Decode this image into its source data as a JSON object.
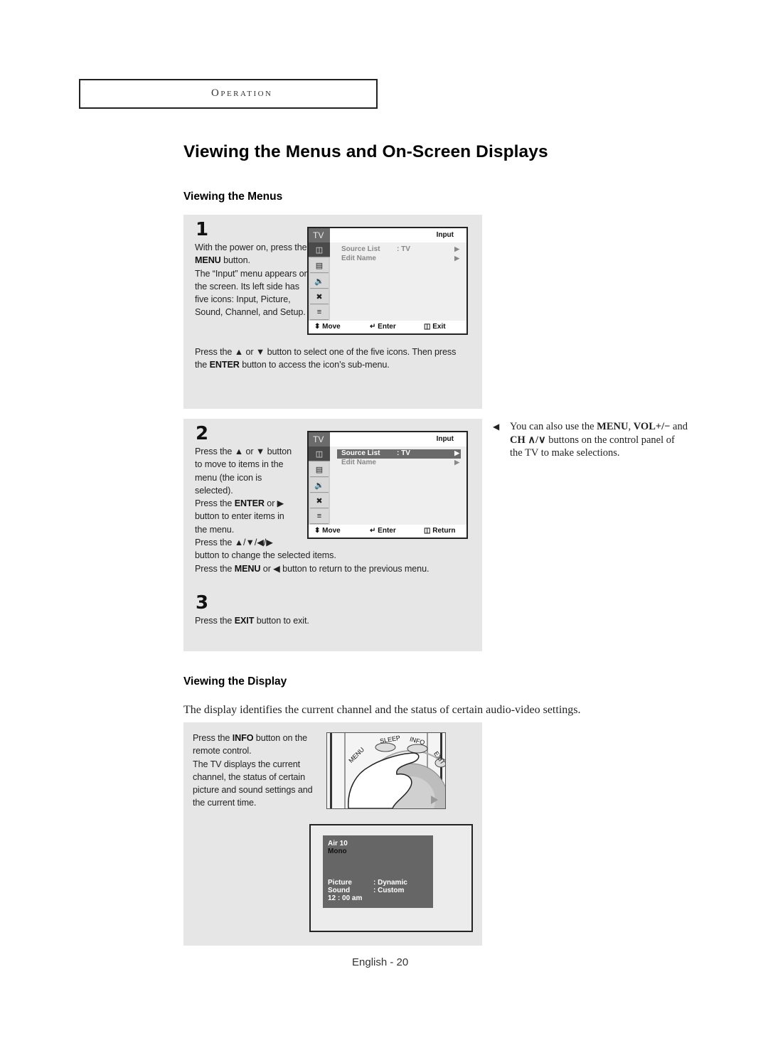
{
  "header": {
    "section": "Operation"
  },
  "page_title": "Viewing the Menus and On-Screen Displays",
  "viewing_menus": {
    "heading": "Viewing the Menus",
    "step1": {
      "number": "1",
      "text_parts": [
        "With the power on, press the ",
        "MENU",
        " button.",
        "The “Input” menu appears on the screen. Its left side has five icons: Input, Picture, Sound, Channel, and Setup."
      ],
      "after_parts": [
        "Press the ▲ or ▼ button to select one of the five icons. Then press the ",
        "ENTER",
        " button to access the icon’s sub-menu."
      ],
      "osd": {
        "tv_label": "TV",
        "title": "Input",
        "icons": [
          "input-icon",
          "picture-icon",
          "sound-icon",
          "channel-icon",
          "setup-icon"
        ],
        "selected_icon": 0,
        "rows": [
          {
            "label": "Source List",
            "value": ": TV",
            "arrow": "▶",
            "highlighted": false
          },
          {
            "label": "Edit Name",
            "value": "",
            "arrow": "▶",
            "highlighted": false
          }
        ],
        "footer": {
          "move": "Move",
          "enter": "Enter",
          "exit": "Exit"
        }
      }
    },
    "step2": {
      "number": "2",
      "lines": [
        [
          "Press the ▲ or ▼ button"
        ],
        [
          "to move to items in the"
        ],
        [
          "menu (the icon is"
        ],
        [
          "selected)."
        ],
        [
          "Press the ",
          "ENTER",
          " or ▶"
        ],
        [
          "button to enter items in"
        ],
        [
          "the menu."
        ],
        [
          "Press the ▲/▼/◀/▶"
        ],
        [
          "button to change the selected items."
        ],
        [
          "Press the ",
          "MENU",
          " or ◀ button to return to the previous menu."
        ]
      ],
      "osd": {
        "tv_label": "TV",
        "title": "Input",
        "selected_icon": 0,
        "rows": [
          {
            "label": "Source List",
            "value": ": TV",
            "arrow": "▶",
            "highlighted": true
          },
          {
            "label": "Edit Name",
            "value": "",
            "arrow": "▶",
            "highlighted": false
          }
        ],
        "footer": {
          "move": "Move",
          "enter": "Enter",
          "exit": "Return"
        }
      }
    },
    "step3": {
      "number": "3",
      "text_parts": [
        "Press the ",
        "EXIT",
        " button to exit."
      ]
    },
    "side_note": {
      "arrow": "◀",
      "parts": [
        "You can also use the ",
        "MENU",
        ", ",
        "VOL+/−",
        " and ",
        "CH ∧/∨",
        " buttons on the control panel of the TV to make selections."
      ]
    }
  },
  "viewing_display": {
    "heading": "Viewing the Display",
    "description": "The display identifies the current channel and the status of certain audio-video settings.",
    "text_parts": [
      "Press the ",
      "INFO",
      " button on the remote control.",
      "The TV displays the current channel, the status of certain picture and sound settings and the current time."
    ],
    "remote_labels": {
      "menu": "MENU",
      "sleep": "SLEEP",
      "info": "INFO",
      "exit": "EXIT"
    },
    "info_screen": {
      "channel": "Air  10",
      "audio": "Mono",
      "picture_label": "Picture",
      "picture_value": ":  Dynamic",
      "sound_label": "Sound",
      "sound_value": ":  Custom",
      "time": "12 : 00 am"
    }
  },
  "footer": {
    "page": "English - 20"
  }
}
